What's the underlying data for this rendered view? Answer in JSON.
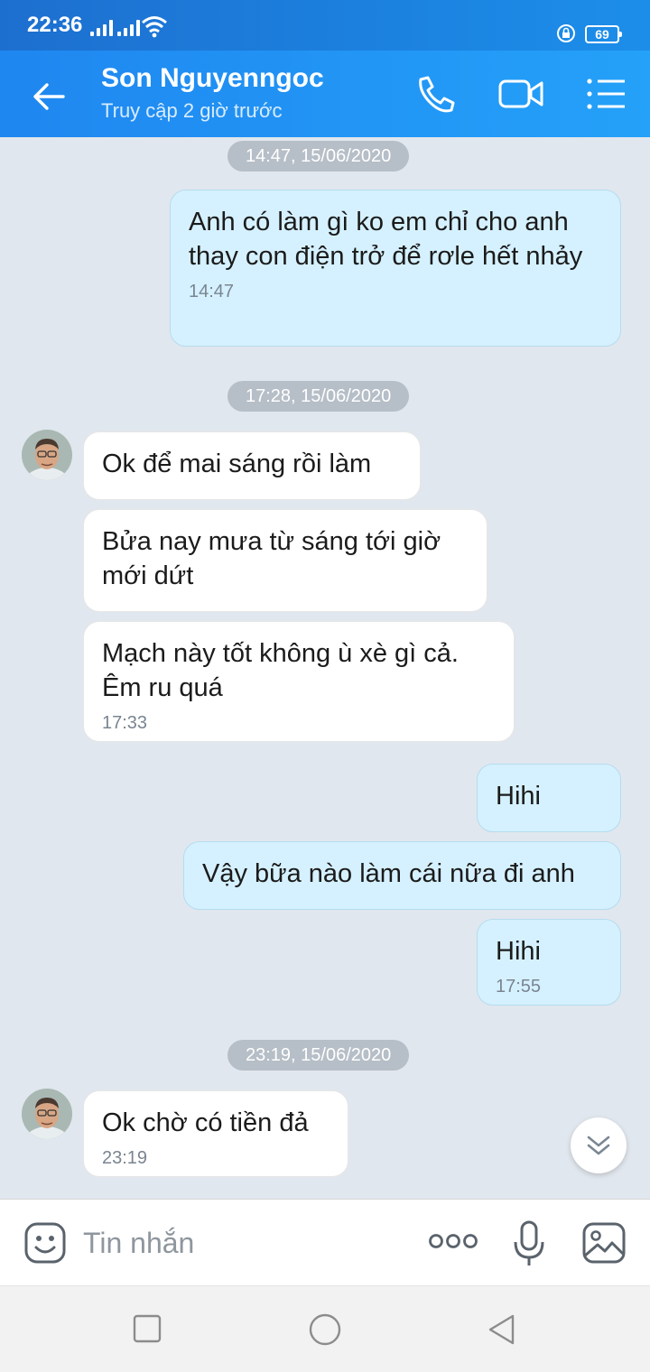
{
  "status_bar": {
    "time": "22:36",
    "battery": "69"
  },
  "header": {
    "title": "Son Nguyenngoc",
    "subtitle": "Truy cập 2 giờ trước",
    "icons": [
      "back-arrow-icon",
      "phone-icon",
      "video-call-icon",
      "menu-list-icon"
    ]
  },
  "chat": {
    "dividers": [
      "14:47, 15/06/2020",
      "17:28, 15/06/2020",
      "23:19, 15/06/2020"
    ],
    "messages": [
      {
        "from": "me",
        "text": "Anh có làm gì ko em chỉ cho anh thay con điện trở để rơle hết nhảy",
        "time": "14:47"
      },
      {
        "from": "them",
        "text": "Ok để mai sáng rồi làm",
        "time": ""
      },
      {
        "from": "them",
        "text": "Bửa nay mưa từ sáng tới giờ mới dứt",
        "time": ""
      },
      {
        "from": "them",
        "text": "Mạch này tốt không ù xè gì cả. Êm ru quá",
        "time": "17:33"
      },
      {
        "from": "me",
        "text": "Hihi",
        "time": ""
      },
      {
        "from": "me",
        "text": "Vậy bữa nào làm cái nữa đi anh",
        "time": ""
      },
      {
        "from": "me",
        "text": "Hihi",
        "time": "17:55"
      },
      {
        "from": "them",
        "text": "Ok chờ có tiền đả",
        "time": "23:19"
      }
    ]
  },
  "input": {
    "placeholder": "Tin nhắn"
  },
  "colors": {
    "header": "#1f87f0",
    "bubble_me": "#d5f1ff",
    "bubble_them": "#ffffff",
    "chat_bg": "#e1e7ee"
  }
}
